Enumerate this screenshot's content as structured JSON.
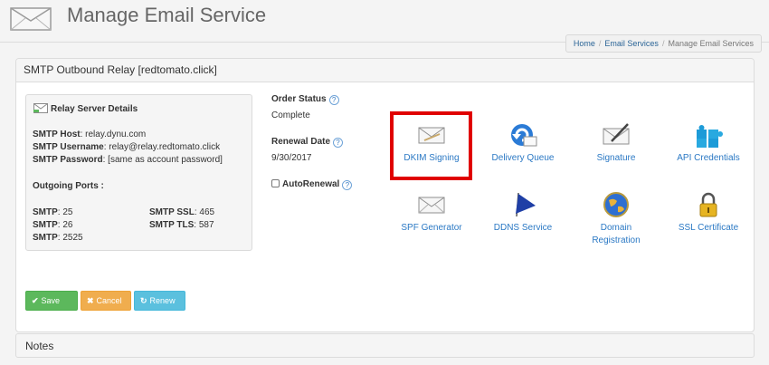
{
  "header": {
    "title": "Manage Email Service",
    "icon": "envelope-icon"
  },
  "breadcrumb": {
    "home": "Home",
    "email_services": "Email Services",
    "current": "Manage Email Services"
  },
  "panel": {
    "title": "SMTP Outbound Relay [redtomato.click]"
  },
  "relay": {
    "title": "Relay Server Details",
    "host_label": "SMTP Host",
    "host_value": ": relay.dynu.com",
    "username_label": "SMTP Username",
    "username_value": ": relay@relay.redtomato.click",
    "password_label": "SMTP Password",
    "password_value": ": [same as account password]",
    "ports_title": "Outgoing Ports :",
    "ports": [
      {
        "label": "SMTP",
        "value": ": 25"
      },
      {
        "label": "SMTP SSL",
        "value": ": 465"
      },
      {
        "label": "SMTP",
        "value": ": 26"
      },
      {
        "label": "SMTP TLS",
        "value": ": 587"
      },
      {
        "label": "SMTP",
        "value": ": 2525"
      }
    ]
  },
  "order": {
    "status_label": "Order Status",
    "status_value": "Complete",
    "renewal_label": "Renewal Date",
    "renewal_value": "9/30/2017",
    "autorenewal_label": "AutoRenewal",
    "autorenewal_checked": false
  },
  "tiles": [
    {
      "label": "DKIM Signing",
      "icon": "envelope-signing-icon"
    },
    {
      "label": "Delivery Queue",
      "icon": "refresh-queue-icon"
    },
    {
      "label": "Signature",
      "icon": "envelope-pen-icon"
    },
    {
      "label": "API Credentials",
      "icon": "puzzle-icon"
    },
    {
      "label": "SPF Generator",
      "icon": "envelope-icon"
    },
    {
      "label": "DDNS Service",
      "icon": "flag-icon"
    },
    {
      "label": "Domain Registration",
      "icon": "globe-icon"
    },
    {
      "label": "SSL Certificate",
      "icon": "lock-icon"
    }
  ],
  "buttons": {
    "save": "Save",
    "cancel": "Cancel",
    "renew": "Renew"
  },
  "notes": {
    "title": "Notes"
  },
  "colors": {
    "highlight": "#e00000",
    "link": "#2a78c4",
    "save": "#5cb85c",
    "cancel": "#f0ad4e",
    "renew": "#5bc0de"
  }
}
